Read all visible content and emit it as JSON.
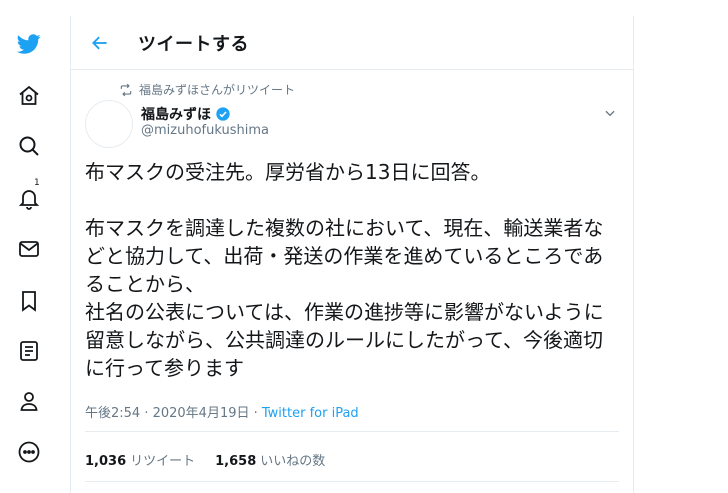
{
  "header": {
    "title": "ツイートする"
  },
  "sidebar": {
    "notifications_badge": "1"
  },
  "tweet": {
    "retweet_note": "福島みずほさんがリツイート",
    "author_name": "福島みずほ",
    "handle": "@mizuhofukushima",
    "text": "布マスクの受注先。厚労省から13日に回答。\n\n布マスクを調達した複数の社において、現在、輸送業者などと協力して、出荷・発送の作業を進めているところであることから、\n社名の公表については、作業の進捗等に影響がないように留意しながら、公共調達のルールにしたがって、今後適切に行って参ります",
    "time": "午後2:54 · 2020年4月19日 · ",
    "source": "Twitter for iPad",
    "retweet_count": "1,036",
    "retweet_label": "リツイート",
    "like_count": "1,658",
    "like_label": "いいねの数"
  },
  "colors": {
    "accent": "#1da1f2",
    "muted": "#657786",
    "border": "#e6ecf0"
  }
}
